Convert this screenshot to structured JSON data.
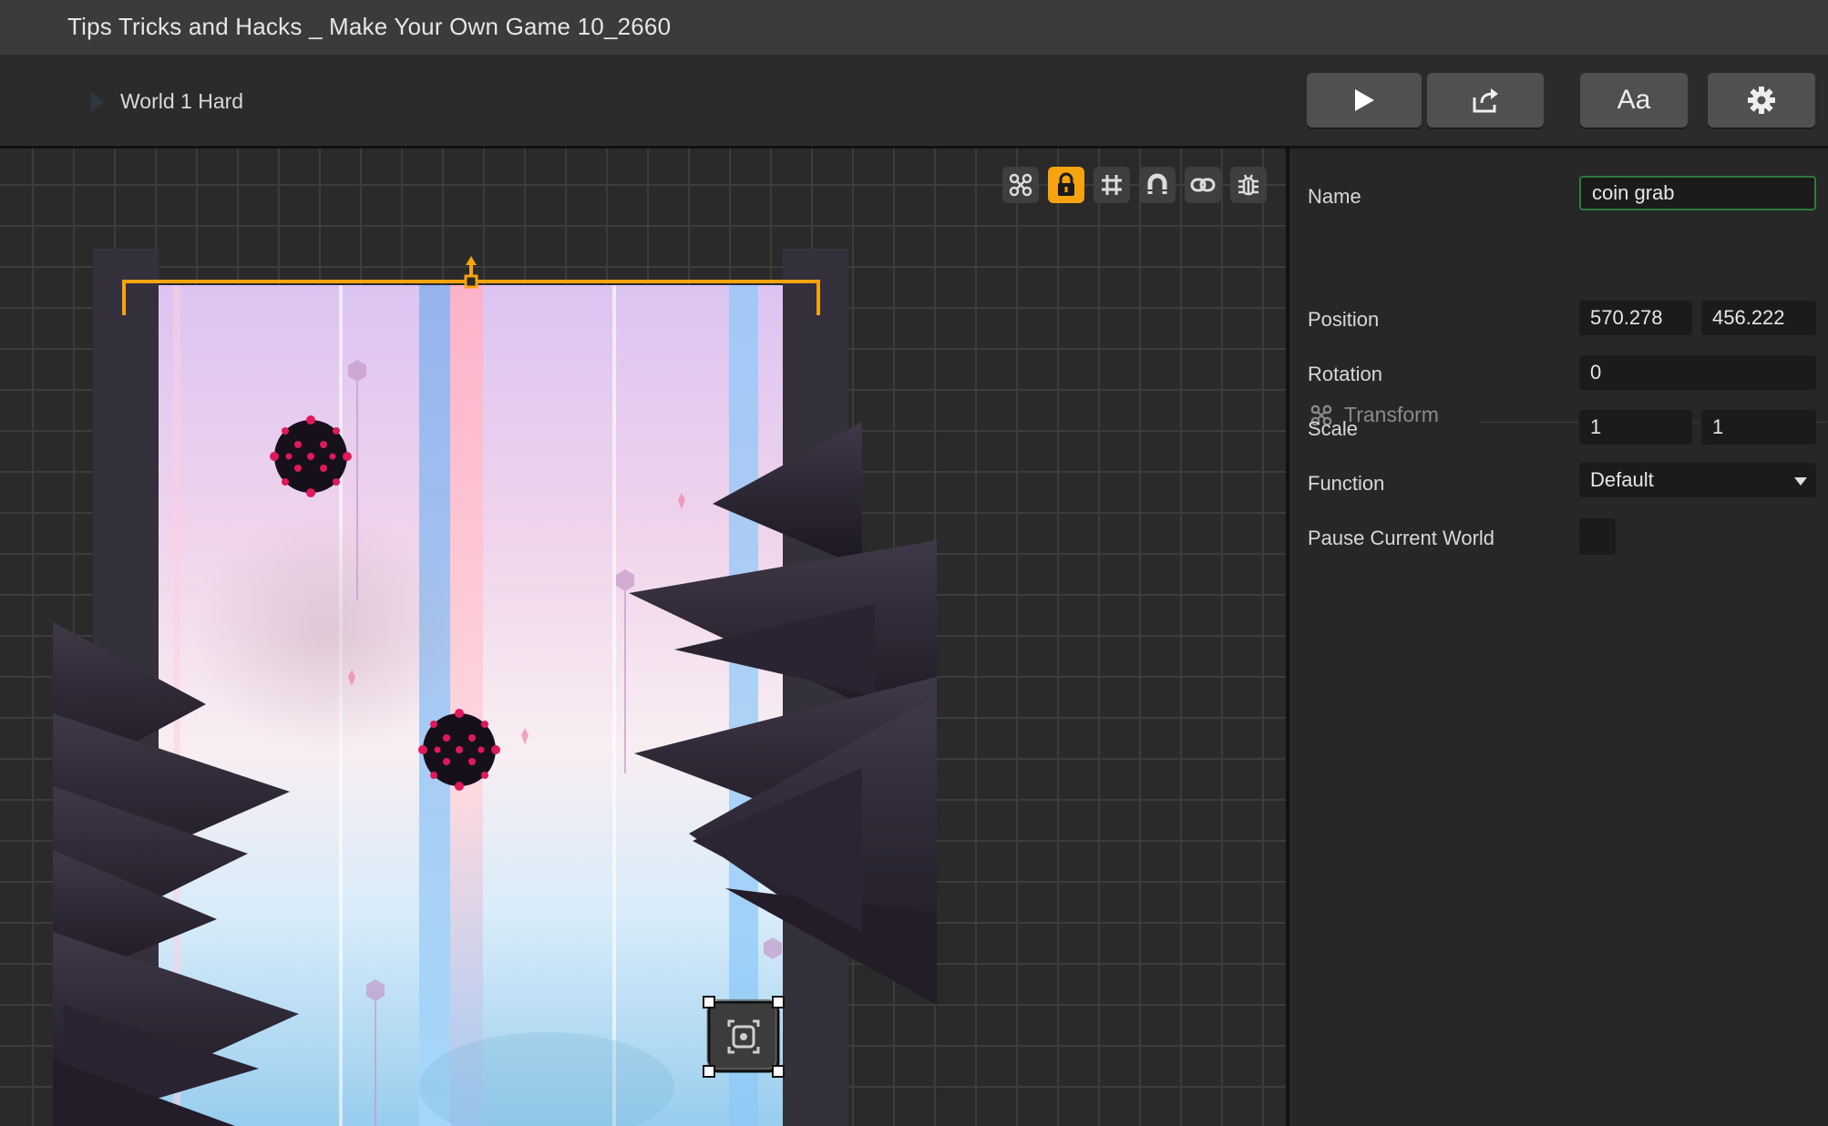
{
  "window": {
    "title": "Tips Tricks and Hacks _ Make Your Own Game 10_2660"
  },
  "toolbar": {
    "breadcrumb": "World 1 Hard",
    "play_icon": "play-icon",
    "share_icon": "share-icon",
    "font_button_label": "Aa",
    "settings_icon": "gear-icon"
  },
  "canvas_tools": [
    {
      "name": "transform-tool-icon",
      "active": false
    },
    {
      "name": "lock-icon",
      "active": true
    },
    {
      "name": "grid-icon",
      "active": false
    },
    {
      "name": "magnet-icon",
      "active": false
    },
    {
      "name": "link-icon",
      "active": false
    },
    {
      "name": "debug-bug-icon",
      "active": false
    }
  ],
  "inspector": {
    "name_label": "Name",
    "name_value": "coin grab",
    "transform_title": "Transform",
    "position_label": "Position",
    "position_x": "570.278",
    "position_y": "456.222",
    "rotation_label": "Rotation",
    "rotation_value": "0",
    "scale_label": "Scale",
    "scale_x": "1",
    "scale_y": "1",
    "function_label": "Function",
    "function_value": "Default",
    "pause_label": "Pause Current World",
    "pause_checked": false
  },
  "colors": {
    "accent": "#f5a30f",
    "spike_ball": "#16101a",
    "spike_dots": "#e0195a",
    "name_border": "#2f7a3f"
  }
}
